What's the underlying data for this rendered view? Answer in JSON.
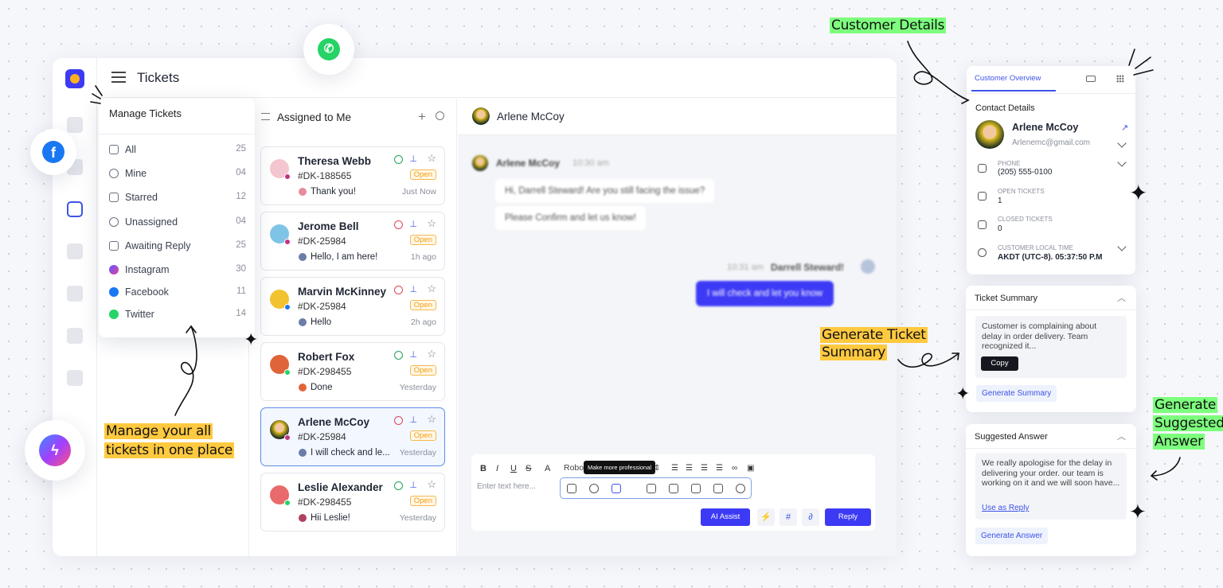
{
  "page": {
    "title": "Tickets"
  },
  "manage": {
    "title": "Manage Tickets",
    "items": [
      {
        "label": "All",
        "count": "25"
      },
      {
        "label": "Mine",
        "count": "04"
      },
      {
        "label": "Starred",
        "count": "12"
      },
      {
        "label": "Unassigned",
        "count": "04"
      },
      {
        "label": "Awaiting Reply",
        "count": "25"
      },
      {
        "label": "Instagram",
        "count": "30"
      },
      {
        "label": "Facebook",
        "count": "11"
      },
      {
        "label": "Twitter",
        "count": "14"
      }
    ]
  },
  "list": {
    "title": "Assigned to Me",
    "plus": "+",
    "tickets": [
      {
        "name": "Theresa Webb",
        "id": "#DK-188565",
        "status": "Open",
        "message": "Thank you!",
        "time": "Just Now"
      },
      {
        "name": "Jerome Bell",
        "id": "#DK-25984",
        "status": "Open",
        "message": "Hello, I am here!",
        "time": "1h ago"
      },
      {
        "name": "Marvin McKinney",
        "id": "#DK-25984",
        "status": "Open",
        "message": "Hello",
        "time": "2h ago"
      },
      {
        "name": "Robert Fox",
        "id": "#DK-298455",
        "status": "Open",
        "message": "Done",
        "time": "Yesterday"
      },
      {
        "name": "Arlene McCoy",
        "id": "#DK-25984",
        "status": "Open",
        "message": "I will check and le...",
        "time": "Yesterday"
      },
      {
        "name": "Leslie Alexander",
        "id": "#DK-298455",
        "status": "Open",
        "message": "Hii Leslie!",
        "time": "Yesterday"
      }
    ]
  },
  "chat": {
    "contact": "Arlene McCoy",
    "incoming_name": "Arlene McCoy",
    "incoming_time": "10:30 am",
    "incoming": [
      "Hi, Darrell Steward! Are you still facing the issue?",
      "Please Confirm and let us know!"
    ],
    "outgoing_name": "Darrell Steward!",
    "outgoing_time": "10:31 am",
    "outgoing": "I will check and let you know"
  },
  "composer": {
    "font": "Robo",
    "placeholder": "Enter text here...",
    "tooltip": "Make more professional",
    "ai_assist": "AI Assist",
    "hash": "#",
    "reply": "Reply"
  },
  "customer": {
    "tab_overview": "Customer Overview",
    "section": "Contact Details",
    "name": "Arlene McCoy",
    "email": "Arlenemc@gmail.com",
    "phone_label": "PHONE",
    "phone": "(205) 555-0100",
    "open_label": "OPEN TICKETS",
    "open": "1",
    "closed_label": "CLOSED TICKETS",
    "closed": "0",
    "time_label": "CUSTOMER LOCAL TIME",
    "time": "AKDT (UTC-8). 05:37:50 P.M"
  },
  "summary": {
    "title": "Ticket Summary",
    "text": "Customer is complaining about delay in order delivery. Team recognized it...",
    "copy": "Copy",
    "generate": "Generate Summary"
  },
  "answer": {
    "title": "Suggested Answer",
    "text": "We really apologise for the delay in delivering your order. our team is working on it and we will soon have...",
    "use": "Use as Reply",
    "generate": "Generate Answer"
  },
  "annotations": {
    "customer_details": "Customer Details",
    "gen_summary_1": "Generate Ticket",
    "gen_summary_2": "Summary",
    "gen_answer_1": "Generate",
    "gen_answer_2": "Suggested",
    "gen_answer_3": "Answer",
    "manage_1": "Manage your all",
    "manage_2": "tickets in one place"
  },
  "icons": {
    "whatsapp": "whatsapp-icon",
    "facebook": "facebook-icon",
    "messenger": "messenger-icon"
  }
}
